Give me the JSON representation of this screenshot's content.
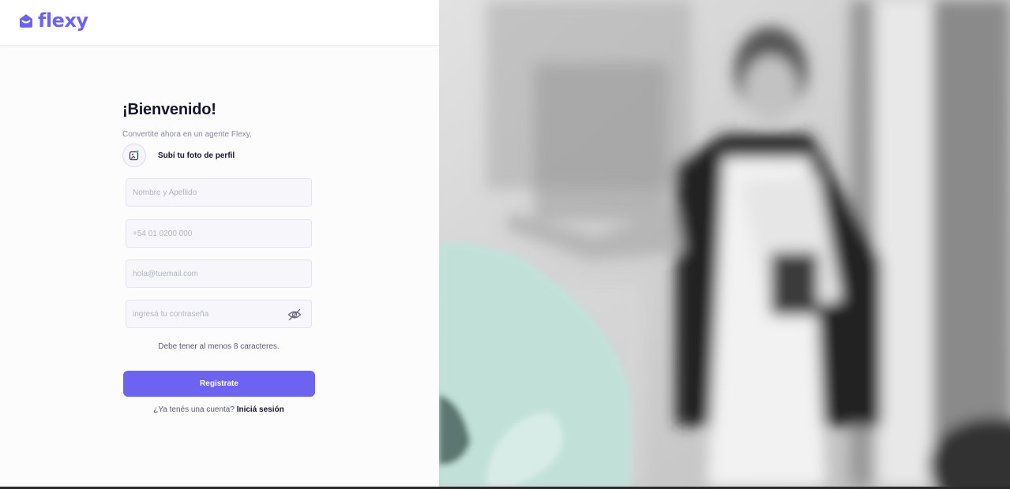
{
  "brand": {
    "name": "flexy",
    "color": "#6c63f0"
  },
  "form": {
    "title": "¡Bienvenido!",
    "subtitle": "Convertite ahora en un agente Flexy.",
    "photo_label": "Subí tu foto de perfil",
    "fields": {
      "name_placeholder": "Nombre y Apellido",
      "phone_placeholder": "+54 01 0200 000",
      "email_placeholder": "hola@tuemail.com",
      "password_placeholder": "ingresá tu contraseña"
    },
    "password_hint": "Debe tener al menos 8 caracteres.",
    "submit_label": "Registrate",
    "login_prompt": "¿Ya tenés una cuenta?",
    "login_link": "Iniciá sesión"
  },
  "hero": {
    "accent_color": "#bfe3d9"
  }
}
